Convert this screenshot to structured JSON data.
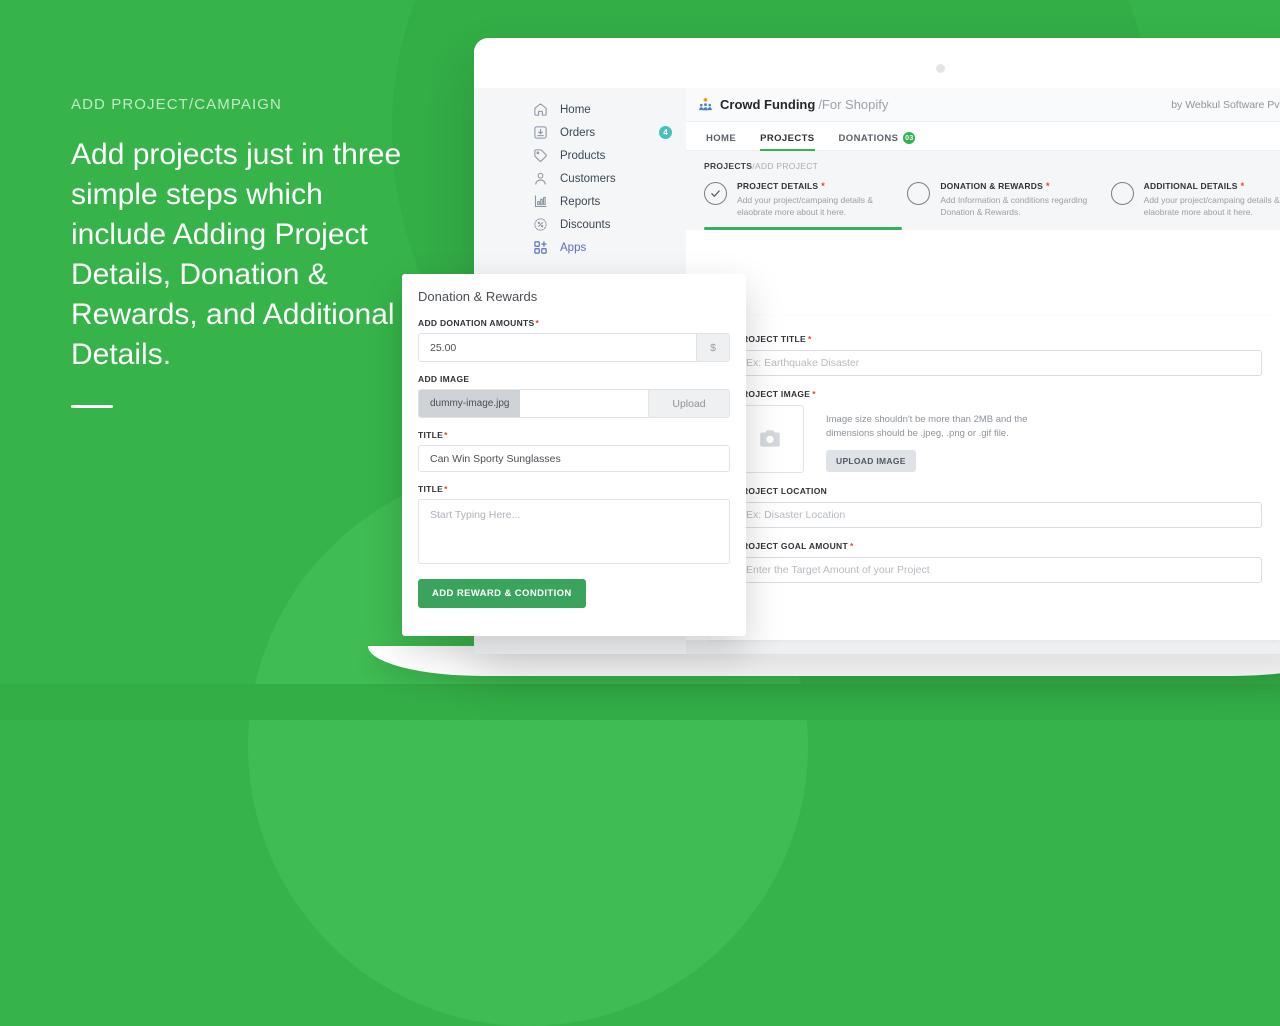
{
  "promo": {
    "eyebrow": "ADD PROJECT/CAMPAIGN",
    "headline": "Add projects just in three simple steps which include Adding Project Details, Donation & Rewards, and Additional Details."
  },
  "sidebar": {
    "items": [
      {
        "label": "Home",
        "icon": "home-icon",
        "badge": ""
      },
      {
        "label": "Orders",
        "icon": "orders-icon",
        "badge": "4"
      },
      {
        "label": "Products",
        "icon": "tag-icon",
        "badge": ""
      },
      {
        "label": "Customers",
        "icon": "user-icon",
        "badge": ""
      },
      {
        "label": "Reports",
        "icon": "bar-chart-icon",
        "badge": ""
      },
      {
        "label": "Discounts",
        "icon": "discount-icon",
        "badge": ""
      },
      {
        "label": "Apps",
        "icon": "apps-icon",
        "badge": ""
      }
    ]
  },
  "app": {
    "brand_name": "Crowd Funding",
    "brand_sub": "/For Shopify",
    "byline": "by Webkul Software Pvt Ltd",
    "tabs": [
      {
        "label": "HOME",
        "badge": "",
        "active": false
      },
      {
        "label": "PROJECTS",
        "badge": "",
        "active": true
      },
      {
        "label": "DONATIONS",
        "badge": "03",
        "active": false
      }
    ],
    "breadcrumb_current": "PROJECTS",
    "breadcrumb_trail": "/ADD PROJECT",
    "steps": [
      {
        "title": "PROJECT DETAILS",
        "required": "*",
        "desc": "Add your project/campaing details & elaobrate more about it here.",
        "complete": true
      },
      {
        "title": "DONATION & REWARDS",
        "required": "*",
        "desc": "Add Information & conditions regarding Donation & Rewards.",
        "complete": false
      },
      {
        "title": "ADDITIONAL DETAILS",
        "required": "*",
        "desc": "Add your project/campaing details & elaobrate more about it here.",
        "complete": false
      }
    ]
  },
  "project_form": {
    "title_label": "PROJECT TITLE",
    "title_required": "*",
    "title_placeholder": "Ex: Earthquake Disaster",
    "image_label": "PROJECT IMAGE",
    "image_required": "*",
    "image_hint": "Image size shouldn't be more than 2MB and the dimensions should be .jpeg, .png or .gif file.",
    "upload_button": "UPLOAD IMAGE",
    "location_label": "PROJECT LOCATION",
    "location_placeholder": "Ex: Disaster Location",
    "goal_label": "PROJECT GOAL AMOUNT",
    "goal_required": "*",
    "goal_placeholder": "Enter the Target Amount of your Project"
  },
  "modal": {
    "title": "Donation & Rewards",
    "amount_label": "ADD DONATION AMOUNTS",
    "amount_required": "*",
    "amount_value": "25.00",
    "amount_suffix": "$",
    "image_label": "ADD IMAGE",
    "file_name": "dummy-image.jpg",
    "upload_label": "Upload",
    "title1_label": "TITLE",
    "title1_required": "*",
    "title1_value": "Can Win Sporty Sunglasses",
    "title2_label": "TITLE",
    "title2_required": "*",
    "title2_placeholder": "Start Typing Here...",
    "submit_label": "ADD REWARD & CONDITION"
  },
  "colors": {
    "bg_green": "#36b44a",
    "accent_green": "#3aaf5c",
    "button_green": "#3aa35c",
    "badge_teal": "#47c1bf",
    "apps_purple": "#5c6ac4",
    "required_red": "#e8432f"
  }
}
